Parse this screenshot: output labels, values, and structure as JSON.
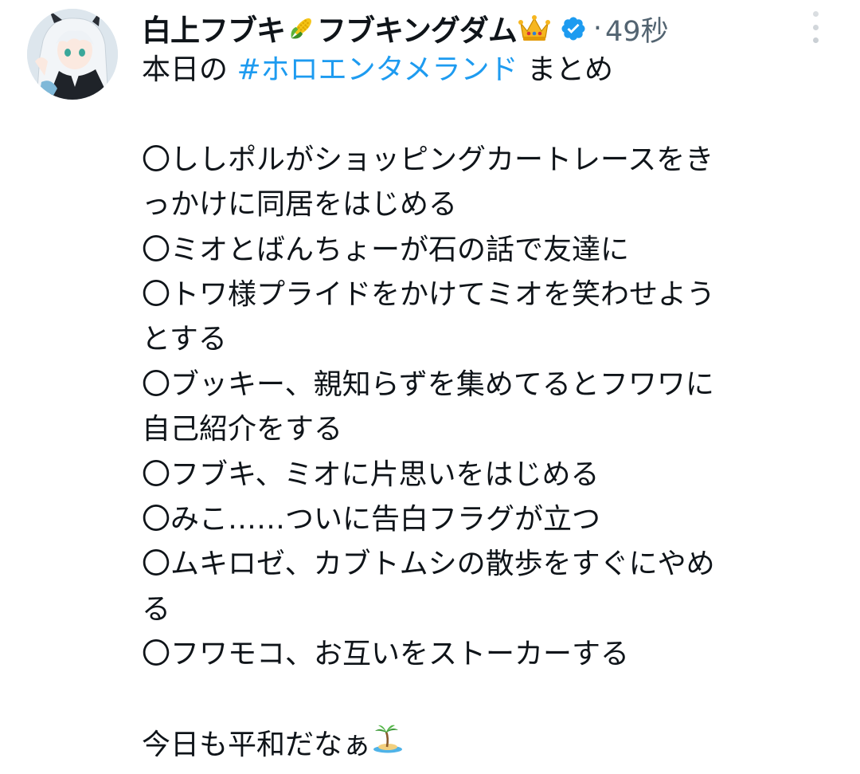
{
  "author": {
    "display_name_part1": "白上フブキ",
    "display_name_part2": "フブキングダム",
    "emoji_after_part1": "corn-icon",
    "emoji_after_part2": "crown-icon",
    "verified": true,
    "verified_icon": "verified-badge-icon",
    "separator": "·",
    "timestamp": "49秒"
  },
  "tweet": {
    "intro_prefix": "本日の ",
    "hashtag": "#ホロエンタメランド",
    "intro_suffix": " まとめ",
    "items": [
      [
        "〇ししポルがショッピングカートレースをき",
        "っかけに同居をはじめる"
      ],
      [
        "〇ミオとばんちょーが石の話で友達に"
      ],
      [
        "〇トワ様プライドをかけてミオを笑わせよう",
        "とする"
      ],
      [
        "〇ブッキー、親知らずを集めてるとフワワに",
        "自己紹介をする"
      ],
      [
        "〇フブキ、ミオに片思いをはじめる"
      ],
      [
        "〇みこ……ついに告白フラグが立つ"
      ],
      [
        "〇ムキロゼ、カブトムシの散歩をすぐにやめ",
        "る"
      ],
      [
        "〇フワモコ、お互いをストーカーする"
      ]
    ],
    "closing": "今日も平和だなぁ",
    "closing_emoji": "desert-island-icon"
  },
  "colors": {
    "text": "#0f1419",
    "hashtag": "#1d9bf0",
    "muted": "#536471",
    "verified": "#1d9bf0"
  }
}
